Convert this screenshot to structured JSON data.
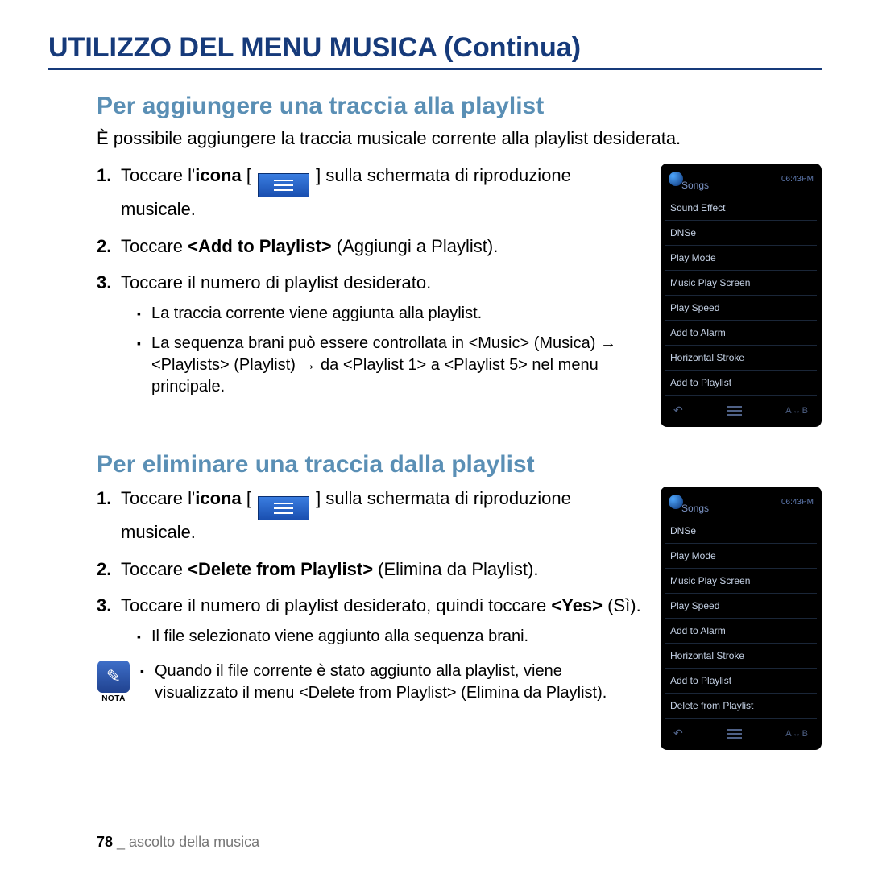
{
  "title": "UTILIZZO DEL MENU MUSICA (Continua)",
  "section1": {
    "heading": "Per aggiungere una traccia alla playlist",
    "intro": "È possibile aggiungere la traccia musicale corrente alla playlist desiderata.",
    "step1_a": "Toccare l'",
    "step1_bold": "icona",
    "step1_lbrac": " [ ",
    "step1_rbrac": " ]",
    "step1_b": " sulla schermata di riproduzione musicale.",
    "step2_a": "Toccare ",
    "step2_bold": "<Add to Playlist>",
    "step2_b": " (Aggiungi a Playlist).",
    "step3": "Toccare il numero di playlist desiderato.",
    "bullet1": "La traccia corrente viene aggiunta alla playlist.",
    "bullet2": "La sequenza brani può essere controllata in <Music> (Musica) → <Playlists> (Playlist) → da <Playlist 1> a <Playlist 5> nel menu principale."
  },
  "section2": {
    "heading": "Per eliminare una traccia dalla playlist",
    "step1_a": "Toccare l'",
    "step1_bold": "icona",
    "step1_lbrac": " [ ",
    "step1_rbrac": " ]",
    "step1_b": " sulla schermata di riproduzione musicale.",
    "step2_a": "Toccare ",
    "step2_bold": "<Delete from Playlist>",
    "step2_b": " (Elimina da Playlist).",
    "step3_a": "Toccare il numero di playlist desiderato, quindi toccare ",
    "step3_bold": "<Yes>",
    "step3_b": " (Sì).",
    "bullet1": "Il file selezionato viene aggiunto alla sequenza brani."
  },
  "nota": {
    "label": "NOTA",
    "text": "Quando il file corrente è stato aggiunto alla playlist, viene visualizzato il menu <Delete from Playlist> (Elimina da Playlist)."
  },
  "device1": {
    "time": "06:43PM",
    "header": "Songs",
    "items": [
      "Sound Effect",
      "DNSe",
      "Play Mode",
      "Music Play Screen",
      "Play Speed",
      "Add to Alarm",
      "Horizontal Stroke",
      "Add to Playlist"
    ],
    "ab": "A↔B"
  },
  "device2": {
    "time": "06:43PM",
    "header": "Songs",
    "items": [
      "DNSe",
      "Play Mode",
      "Music Play Screen",
      "Play Speed",
      "Add to Alarm",
      "Horizontal Stroke",
      "Add to Playlist",
      "Delete from Playlist"
    ],
    "ab": "A↔B"
  },
  "footer": {
    "page": "78",
    "sep": " _ ",
    "section": "ascolto della musica"
  }
}
